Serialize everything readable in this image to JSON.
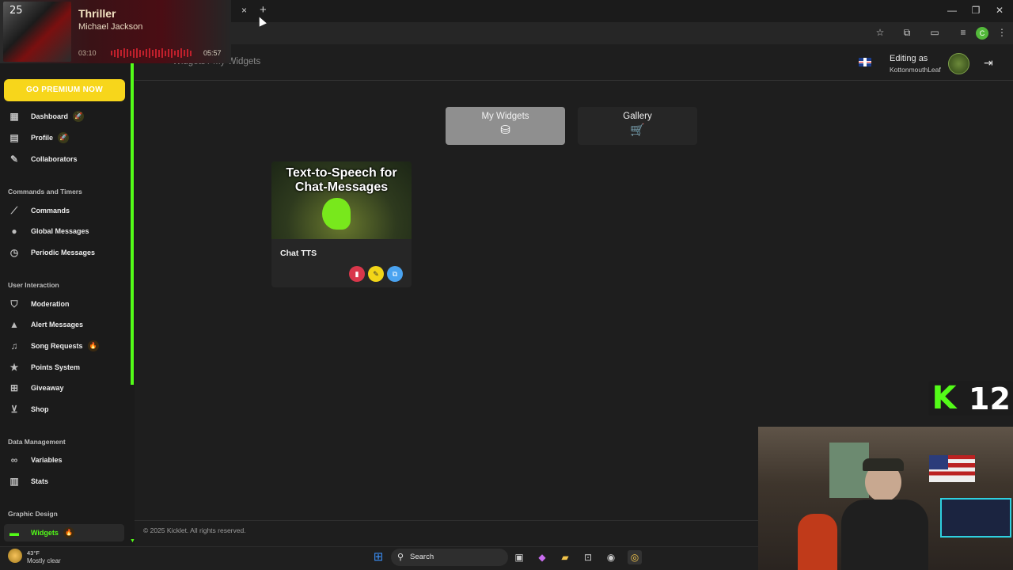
{
  "browser": {
    "tab_close": "×",
    "tab_new": "+",
    "window": {
      "minimize": "—",
      "restore": "❐",
      "close": "✕"
    },
    "toolbar_profile_letter": "C"
  },
  "music": {
    "album_number": "25",
    "title": "Thriller",
    "artist": "Michael Jackson",
    "elapsed": "03:10",
    "total": "05:57"
  },
  "header": {
    "breadcrumb": "Widgets  /  My Widgets",
    "editing_label": "Editing as",
    "editing_user": "KottonmouthLeaf"
  },
  "sidebar": {
    "premium_label": "GO PREMIUM NOW",
    "top_items": [
      {
        "label": "Dashboard",
        "icon": "dashboard-icon",
        "badge": "🚀"
      },
      {
        "label": "Profile",
        "icon": "profile-icon",
        "badge": "🚀"
      },
      {
        "label": "Collaborators",
        "icon": "collaborators-icon"
      }
    ],
    "sections": [
      {
        "title": "Commands and Timers",
        "items": [
          {
            "label": "Commands",
            "icon": "wand-icon"
          },
          {
            "label": "Global Messages",
            "icon": "chat-bubble-icon"
          },
          {
            "label": "Periodic Messages",
            "icon": "clock-icon"
          }
        ]
      },
      {
        "title": "User Interaction",
        "items": [
          {
            "label": "Moderation",
            "icon": "shield-icon"
          },
          {
            "label": "Alert Messages",
            "icon": "alert-icon"
          },
          {
            "label": "Song Requests",
            "icon": "music-note-icon",
            "badge": "🔥"
          },
          {
            "label": "Points System",
            "icon": "star-icon"
          },
          {
            "label": "Giveaway",
            "icon": "gift-icon"
          },
          {
            "label": "Shop",
            "icon": "cart-icon"
          }
        ]
      },
      {
        "title": "Data Management",
        "items": [
          {
            "label": "Variables",
            "icon": "link-icon"
          },
          {
            "label": "Stats",
            "icon": "bar-chart-icon"
          }
        ]
      },
      {
        "title": "Graphic Design",
        "items": [
          {
            "label": "Widgets",
            "icon": "widgets-icon",
            "badge": "🔥"
          }
        ]
      }
    ]
  },
  "main": {
    "tabs": [
      {
        "label": "My Widgets",
        "icon": "database-icon"
      },
      {
        "label": "Gallery",
        "icon": "cart-icon"
      }
    ],
    "widget": {
      "image_title": "Text-to-Speech for Chat-Messages",
      "name": "Chat TTS",
      "actions": [
        {
          "name": "delete",
          "color": "#d9374b"
        },
        {
          "name": "edit",
          "color": "#f2d518"
        },
        {
          "name": "copy",
          "color": "#4aa3f0"
        }
      ]
    },
    "footer": "© 2025 Kicklet. All rights reserved."
  },
  "kick_overlay": {
    "letter": "K",
    "count": "12",
    "color": "#53fc18"
  },
  "taskbar": {
    "weather_temp": "43°F",
    "weather_desc": "Mostly clear",
    "search_label": "Search"
  },
  "colors": {
    "accent": "#53fc18",
    "premium": "#f7d61b"
  }
}
